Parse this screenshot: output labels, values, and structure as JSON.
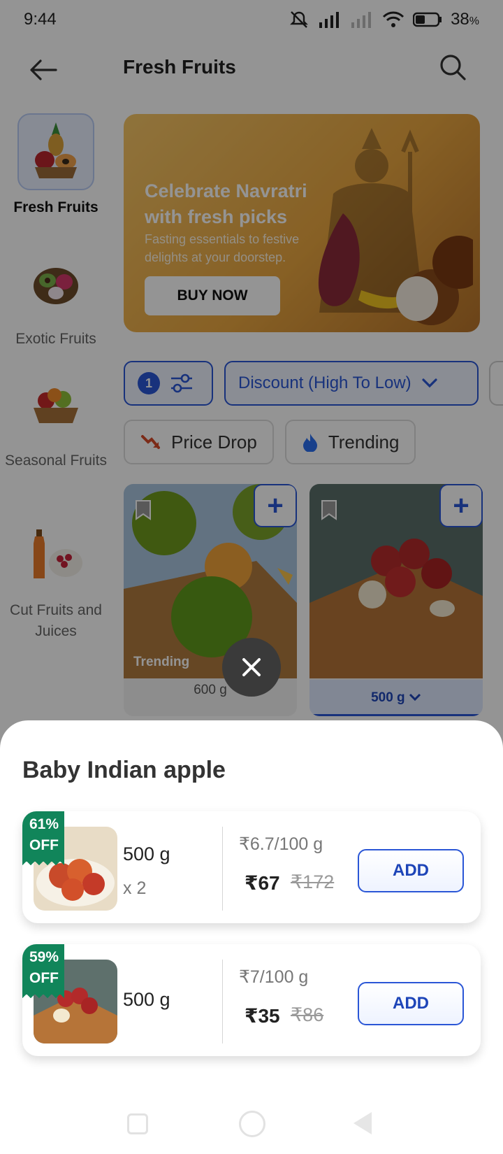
{
  "status_bar": {
    "time": "9:44",
    "battery": "38"
  },
  "header": {
    "title": "Fresh Fruits"
  },
  "sidebar": {
    "items": [
      {
        "label": "Fresh Fruits"
      },
      {
        "label": "Exotic Fruits"
      },
      {
        "label": "Seasonal Fruits"
      },
      {
        "label": "Cut Fruits and Juices"
      }
    ]
  },
  "banner": {
    "title": "Celebrate Navratri with fresh picks",
    "subtitle": "Fasting essentials to festive delights at your doorstep.",
    "button": "BUY NOW"
  },
  "filters": {
    "count": "1",
    "sort_label": "Discount (High To Low)",
    "chips": [
      "Price Drop",
      "Trending"
    ]
  },
  "products": [
    {
      "tag": "Trending",
      "weight": "600 g"
    },
    {
      "tag": "",
      "weight": "500 g"
    }
  ],
  "sheet": {
    "title": "Baby Indian apple",
    "variants": [
      {
        "discount": "61%",
        "off": "OFF",
        "size": "500 g",
        "qty": "x 2",
        "unit_price": "₹6.7/100 g",
        "price": "₹67",
        "mrp": "₹172",
        "add": "ADD"
      },
      {
        "discount": "59%",
        "off": "OFF",
        "size": "500 g",
        "qty": "",
        "unit_price": "₹7/100 g",
        "price": "₹35",
        "mrp": "₹86",
        "add": "ADD"
      }
    ]
  }
}
